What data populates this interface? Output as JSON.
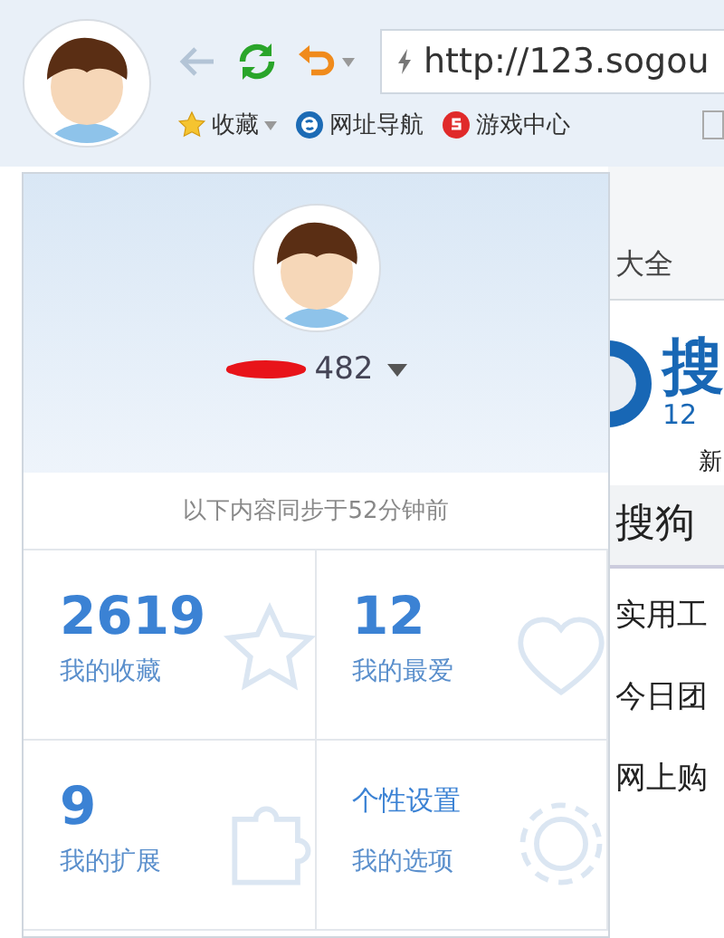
{
  "toolbar": {
    "address": "http://123.sogou",
    "bookmarks": [
      {
        "kind": "star",
        "label": "收藏",
        "has_menu": true
      },
      {
        "kind": "sogou",
        "label": "网址导航",
        "has_menu": false
      },
      {
        "kind": "game",
        "label": "游戏中心",
        "has_menu": false
      }
    ]
  },
  "page_behind": {
    "tab_text": "大全",
    "logo_text": "搜",
    "logo_sub": "12",
    "tab_label": "新",
    "heading": "搜狗",
    "links": [
      "实用工",
      "今日团",
      "网上购"
    ]
  },
  "user_panel": {
    "username": "482",
    "sync_note": "以下内容同步于52分钟前",
    "cells": [
      {
        "kind": "count",
        "value": "2619",
        "label": "我的收藏"
      },
      {
        "kind": "count",
        "value": "12",
        "label": "我的最爱"
      },
      {
        "kind": "count",
        "value": "9",
        "label": "我的扩展"
      },
      {
        "kind": "link",
        "value": "个性设置",
        "label": "我的选项"
      }
    ]
  }
}
